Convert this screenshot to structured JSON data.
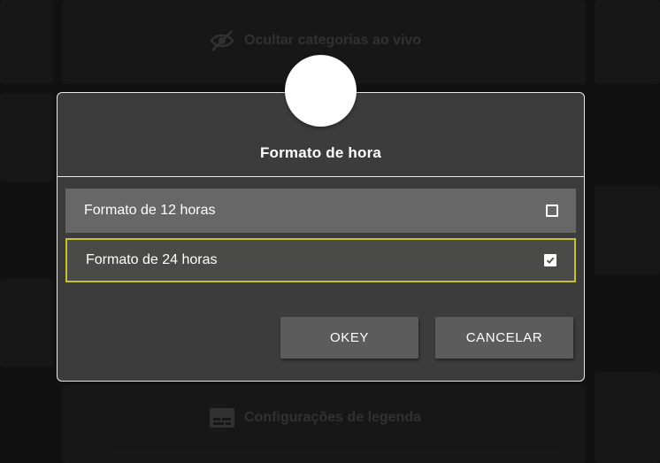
{
  "background": {
    "item_top_label": "Ocultar categorias ao vivo",
    "item_top_icon": "eye-off-icon",
    "item_bottom_label": "Configurações de legenda",
    "item_bottom_icon": "subtitles-icon"
  },
  "dialog": {
    "title": "Formato de hora",
    "options": [
      {
        "label": "Formato de 12 horas",
        "checked": false
      },
      {
        "label": "Formato de 24 horas",
        "checked": true
      }
    ],
    "ok_label": "OKEY",
    "cancel_label": "CANCELAR"
  },
  "colors": {
    "dialog_bg": "#3c3c3c",
    "dialog_border": "#e8e8e8",
    "option_bg": "#666766",
    "option_selected_bg": "#4a4a48",
    "focus_border": "#c6c22a",
    "button_bg": "#5b5c5b"
  }
}
